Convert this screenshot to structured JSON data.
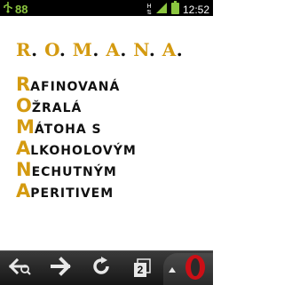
{
  "status_bar": {
    "notification_count": "88",
    "network": "H",
    "time": "12:52",
    "icons": [
      "usb-icon",
      "hspa-icon",
      "signal-icon",
      "battery-icon"
    ]
  },
  "acronym": {
    "title_letters": [
      "R",
      "O",
      "M",
      "A",
      "N",
      "A"
    ],
    "lines": [
      {
        "initial": "R",
        "rest": "afinovaná"
      },
      {
        "initial": "O",
        "rest": "žralá"
      },
      {
        "initial": "M",
        "rest": "átoha s"
      },
      {
        "initial": "A",
        "rest": "lkoholovým"
      },
      {
        "initial": "N",
        "rest": "echutným"
      },
      {
        "initial": "A",
        "rest": "peritivem"
      }
    ]
  },
  "toolbar": {
    "buttons": [
      "back-icon",
      "forward-icon",
      "reload-icon",
      "tabs-icon",
      "opera-menu-icon"
    ],
    "tab_count": "2"
  },
  "colors": {
    "accent": "#d49a10",
    "text": "#111111",
    "status_green": "#8bc53f",
    "opera_red": "#cc0f16"
  }
}
